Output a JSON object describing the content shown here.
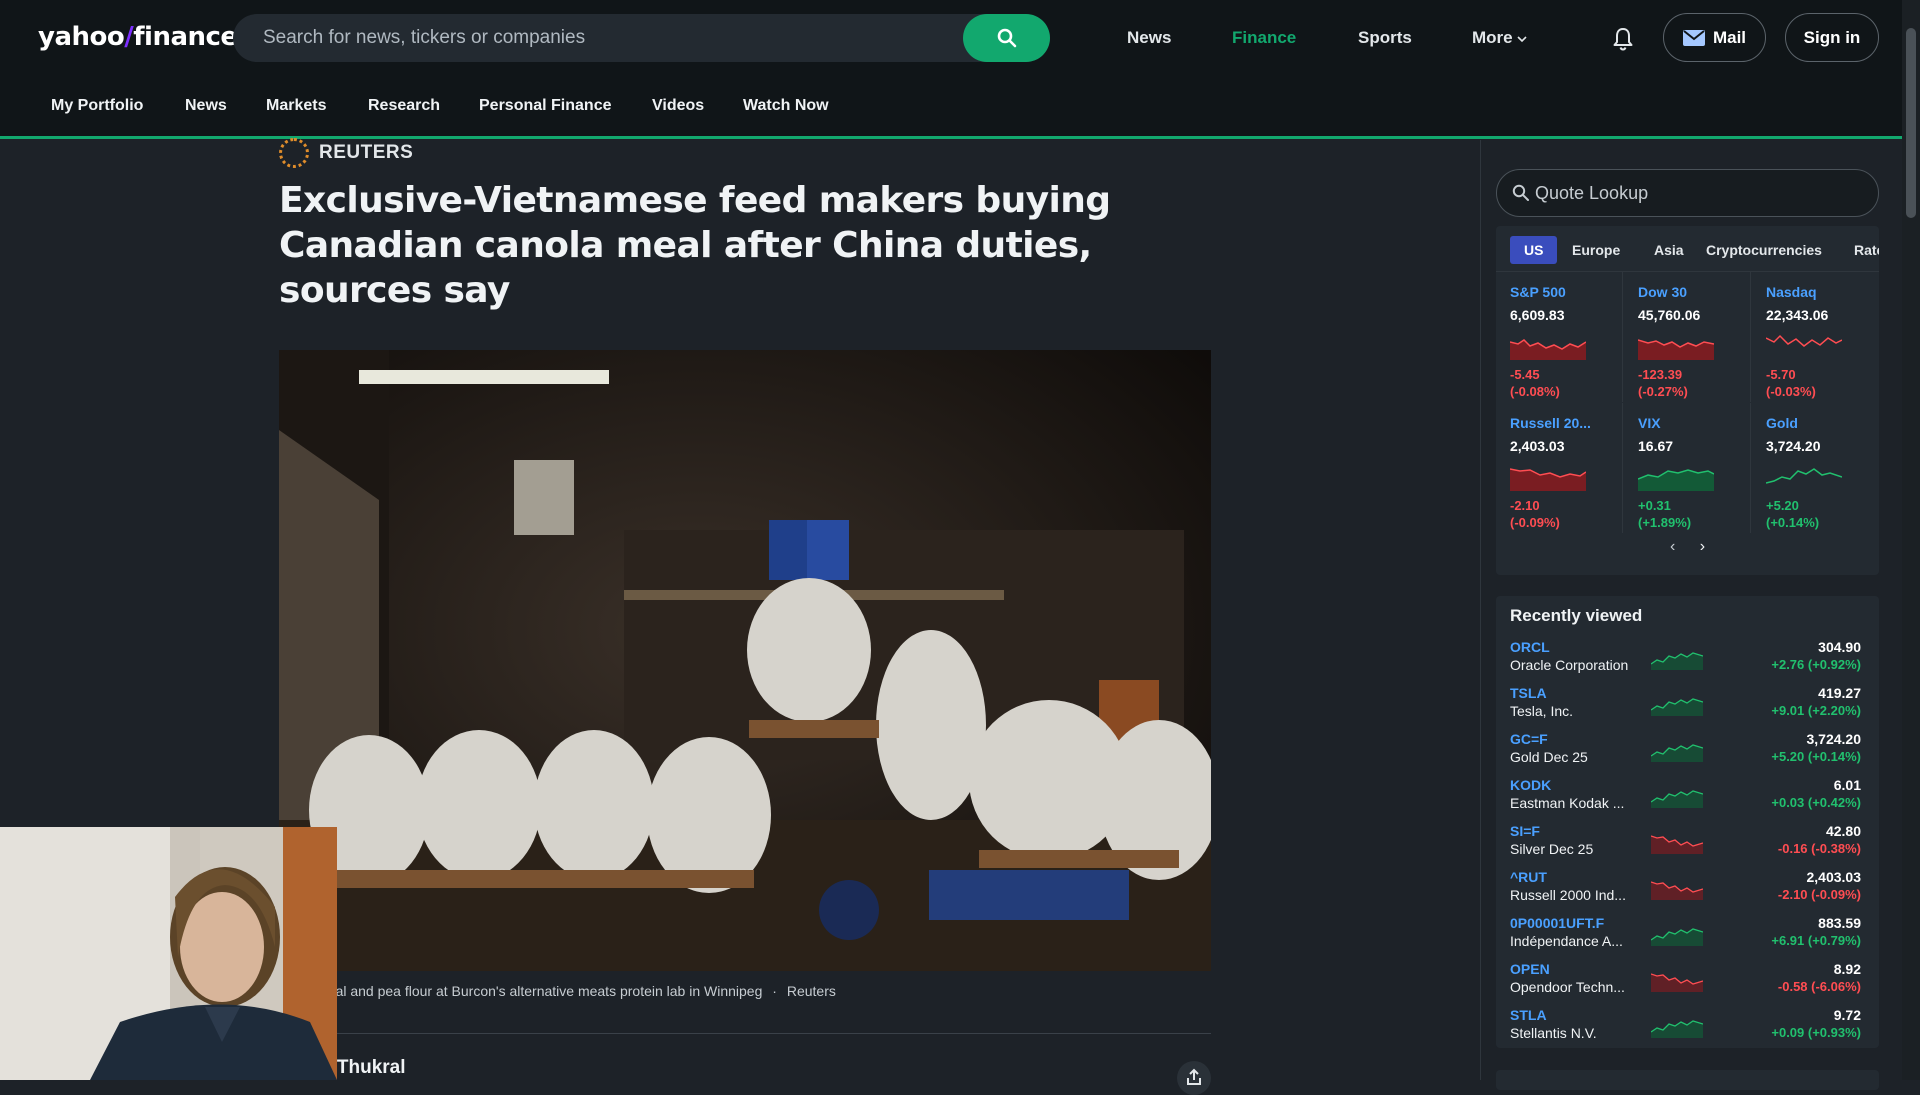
{
  "header": {
    "logo": {
      "brand": "yahoo",
      "slash": "/",
      "product": "finance"
    },
    "search_placeholder": "Search for news, tickers or companies",
    "nav": [
      "News",
      "Finance",
      "Sports",
      "More"
    ],
    "active_nav": "Finance",
    "mail_label": "Mail",
    "signin_label": "Sign in"
  },
  "subnav": [
    "My Portfolio",
    "News",
    "Markets",
    "Research",
    "Personal Finance",
    "Videos",
    "Watch Now"
  ],
  "article": {
    "source": "REUTERS",
    "headline": "Exclusive-Vietnamese feed makers buying Canadian canola meal after China duties, sources say",
    "caption_text": "neal and pea flour at Burcon's alternative meats protein lab in Winnipeg",
    "caption_sep": "·",
    "caption_credit": "Reuters",
    "author_fragment": "n Thukral"
  },
  "sidebar": {
    "quote_lookup_placeholder": "Quote Lookup",
    "market_tabs": [
      "US",
      "Europe",
      "Asia",
      "Cryptocurrencies",
      "Rate"
    ],
    "markets": [
      {
        "name": "S&P 500",
        "price": "6,609.83",
        "change": "-5.45",
        "pct": "(-0.08%)",
        "dir": "neg"
      },
      {
        "name": "Dow 30",
        "price": "45,760.06",
        "change": "-123.39",
        "pct": "(-0.27%)",
        "dir": "neg"
      },
      {
        "name": "Nasdaq",
        "price": "22,343.06",
        "change": "-5.70",
        "pct": "(-0.03%)",
        "dir": "neg"
      },
      {
        "name": "Russell 20...",
        "price": "2,403.03",
        "change": "-2.10",
        "pct": "(-0.09%)",
        "dir": "neg"
      },
      {
        "name": "VIX",
        "price": "16.67",
        "change": "+0.31",
        "pct": "(+1.89%)",
        "dir": "pos"
      },
      {
        "name": "Gold",
        "price": "3,724.20",
        "change": "+5.20",
        "pct": "(+0.14%)",
        "dir": "pos"
      }
    ],
    "carousel_prev": "‹",
    "carousel_next": "›",
    "recently_viewed_title": "Recently viewed",
    "recently_viewed": [
      {
        "symbol": "ORCL",
        "name": "Oracle Corporation",
        "price": "304.90",
        "change": "+2.76 (+0.92%)",
        "dir": "pos"
      },
      {
        "symbol": "TSLA",
        "name": "Tesla, Inc.",
        "price": "419.27",
        "change": "+9.01 (+2.20%)",
        "dir": "pos"
      },
      {
        "symbol": "GC=F",
        "name": "Gold Dec 25",
        "price": "3,724.20",
        "change": "+5.20 (+0.14%)",
        "dir": "pos"
      },
      {
        "symbol": "KODK",
        "name": "Eastman Kodak ...",
        "price": "6.01",
        "change": "+0.03 (+0.42%)",
        "dir": "pos"
      },
      {
        "symbol": "SI=F",
        "name": "Silver Dec 25",
        "price": "42.80",
        "change": "-0.16 (-0.38%)",
        "dir": "neg"
      },
      {
        "symbol": "^RUT",
        "name": "Russell 2000 Ind...",
        "price": "2,403.03",
        "change": "-2.10 (-0.09%)",
        "dir": "neg"
      },
      {
        "symbol": "0P00001UFT.F",
        "name": "Indépendance A...",
        "price": "883.59",
        "change": "+6.91 (+0.79%)",
        "dir": "pos"
      },
      {
        "symbol": "OPEN",
        "name": "Opendoor Techn...",
        "price": "8.92",
        "change": "-0.58 (-6.06%)",
        "dir": "neg"
      },
      {
        "symbol": "STLA",
        "name": "Stellantis N.V.",
        "price": "9.72",
        "change": "+0.09 (+0.93%)",
        "dir": "pos"
      }
    ]
  },
  "colors": {
    "accent_green": "#12a86e",
    "positive": "#21c06e",
    "negative": "#ff4d52",
    "link_blue": "#4aa0ff",
    "tab_active": "#3a4dbd"
  },
  "icons": [
    "search-icon",
    "bell-icon",
    "mail-icon",
    "share-icon"
  ]
}
